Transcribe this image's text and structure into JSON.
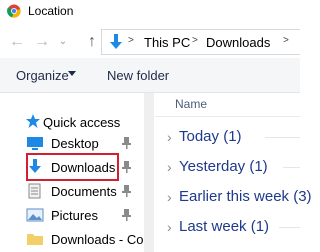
{
  "window": {
    "title": "Location"
  },
  "address_bar": {
    "crumbs": [
      "This PC",
      "Downloads"
    ],
    "separator": ">"
  },
  "toolbar": {
    "organize_label": "Organize",
    "new_folder_label": "New folder"
  },
  "nav_pane": {
    "quick_access_label": "Quick access",
    "items": [
      {
        "label": "Desktop",
        "icon": "desktop-icon",
        "pinned": true
      },
      {
        "label": "Downloads",
        "icon": "download-arrow-icon",
        "pinned": true,
        "highlighted": true
      },
      {
        "label": "Documents",
        "icon": "documents-icon",
        "pinned": true
      },
      {
        "label": "Pictures",
        "icon": "pictures-icon",
        "pinned": true
      },
      {
        "label": "Downloads - Co",
        "icon": "folder-icon",
        "pinned": false
      }
    ]
  },
  "content": {
    "column_header": "Name",
    "groups": [
      {
        "label": "Today (1)"
      },
      {
        "label": "Yesterday (1)"
      },
      {
        "label": "Earlier this week (3)"
      },
      {
        "label": "Last week (1)"
      }
    ]
  },
  "colors": {
    "accent_blue": "#1e88e5",
    "highlight_red": "#d32030",
    "group_text": "#1e3a8a"
  }
}
